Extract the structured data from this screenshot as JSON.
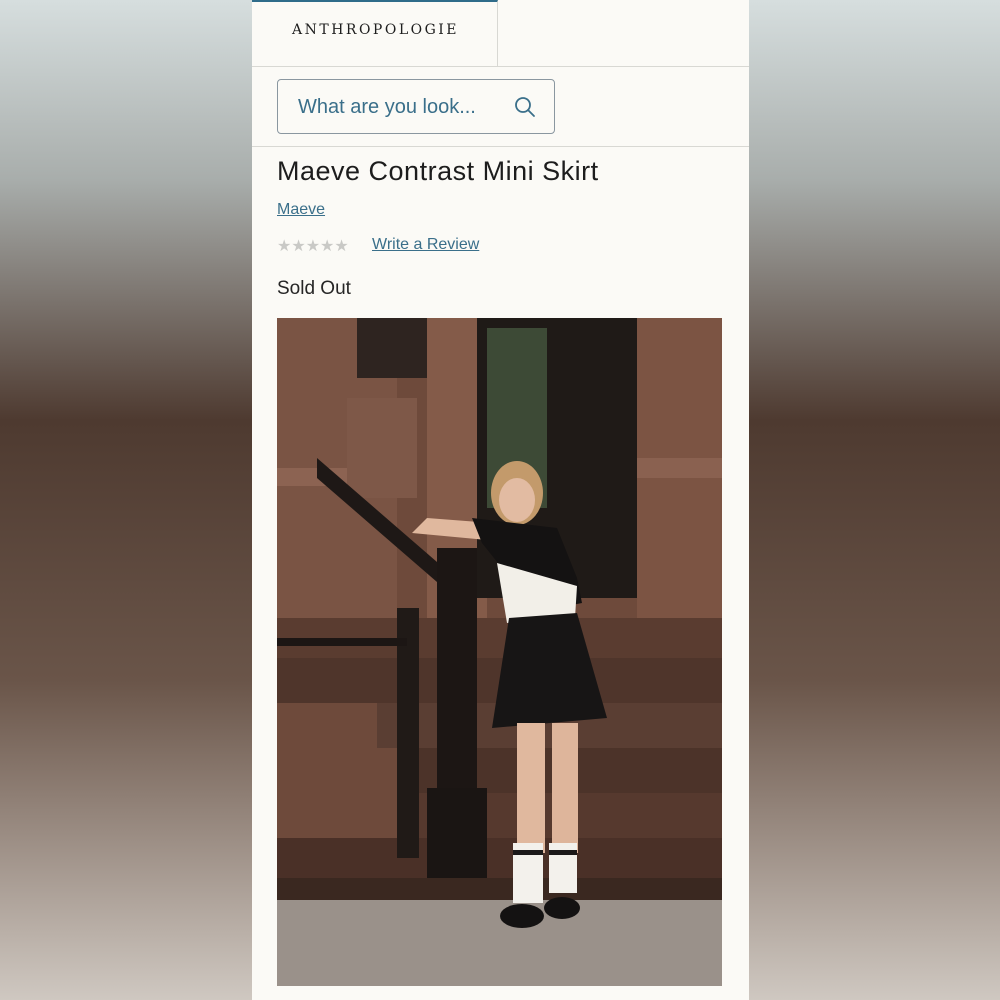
{
  "brand": {
    "logo": "ANTHROPOLOGIE"
  },
  "search": {
    "placeholder": "What are you look..."
  },
  "product": {
    "title": "Maeve Contrast Mini Skirt",
    "brand_link": "Maeve",
    "rating_stars": 0,
    "rating_max": 5,
    "review_link": "Write a Review",
    "availability": "Sold Out"
  },
  "icons": {
    "search": "search-icon",
    "rating": "star-icon"
  },
  "colors": {
    "link": "#3a6f8a",
    "text": "#1d1d1d",
    "star_empty": "#c9c9c6",
    "accent": "#2f6c8a"
  }
}
